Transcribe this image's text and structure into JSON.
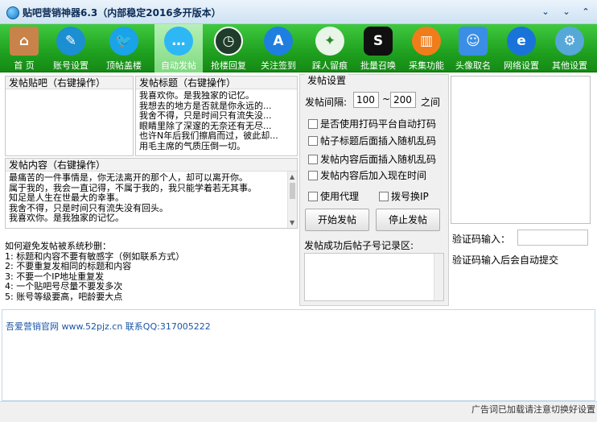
{
  "window": {
    "title": "贴吧营销神器6.3（内部稳定2016多开版本）",
    "controls": [
      "v",
      "v",
      "^",
      "x"
    ]
  },
  "toolbar": {
    "items": [
      {
        "label": "首 页",
        "icon": "house-icon",
        "color": "#c8834a"
      },
      {
        "label": "账号设置",
        "icon": "feather-icon",
        "color": "#1b8fd2"
      },
      {
        "label": "顶帖盖楼",
        "icon": "twitter-bird-icon",
        "color": "#1aa3e8"
      },
      {
        "label": "自动发帖",
        "icon": "chat-bubble-icon",
        "color": "#2db7f5"
      },
      {
        "label": "抢楼回复",
        "icon": "clock-icon",
        "color": "#1f3d2a"
      },
      {
        "label": "关注签到",
        "icon": "appstore-icon",
        "color": "#1e7fe0"
      },
      {
        "label": "踩人留痕",
        "icon": "dragon-icon",
        "color": "#e9f5e9"
      },
      {
        "label": "批量召唤",
        "icon": "skype-icon",
        "color": "#101010"
      },
      {
        "label": "采集功能",
        "icon": "book-icon",
        "color": "#f07d1a"
      },
      {
        "label": "头像取名",
        "icon": "finder-face-icon",
        "color": "#3a8ee6"
      },
      {
        "label": "网络设置",
        "icon": "ie-icon",
        "color": "#1a73d9"
      },
      {
        "label": "其他设置",
        "icon": "gear-icon",
        "color": "#56a8d8"
      }
    ]
  },
  "post_bar": {
    "header": "发帖贴吧（右键操作）"
  },
  "post_title": {
    "header": "发帖标题（右键操作）",
    "lines": [
      "我喜欢你。是我独家的记忆。",
      "我想去的地方是否就是你永远的...",
      "我舍不得，只是时间只有流失没...",
      "眼睛里除了深邃的无奈还有无尽...",
      "也许N年后我们擦肩而过，彼此却...",
      "用毛主席的气质压倒一切。"
    ]
  },
  "post_content": {
    "header": "发帖内容（右键操作）",
    "lines": [
      "最痛苦的一件事情是，你无法离开的那个人，却可以离开你。",
      "属于我的，我会一直记得，不属于我的，我只能学着若无其事。",
      "知足是人生在世最大的幸事。",
      "我舍不得，只是时间只有流失没有回头。",
      "我喜欢你。是我独家的记忆。"
    ]
  },
  "tips": {
    "title": "如何避免发帖被系统秒删：",
    "lines": [
      "1: 标题和内容不要有敏感字（例如联系方式）",
      "2: 不要重复发相同的标题和内容",
      "3: 不要一个IP地址重复发",
      "4: 一个贴吧号尽量不要发多次",
      "5: 账号等级要高，吧龄要大点"
    ]
  },
  "settings": {
    "title": "发帖设置",
    "interval_label": "发帖间隔:",
    "interval_from": "100",
    "interval_sep": "~",
    "interval_to": "200",
    "interval_unit": "之间",
    "checkboxes": [
      "是否使用打码平台自动打码",
      "帖子标题后面插入随机乱码",
      "发帖内容后面插入随机乱码",
      "发帖内容后加入现在时间"
    ],
    "use_proxy": "使用代理",
    "dial_ip": "拨号换IP",
    "start_button": "开始发帖",
    "stop_button": "停止发帖"
  },
  "records": {
    "label": "发帖成功后帖子号记录区:"
  },
  "captcha": {
    "input_label": "验证码输入：",
    "note": "验证码输入后会自动提交"
  },
  "log": {
    "line": "吾爱营销官网 www.52pjz.cn 联系QQ:317005222"
  },
  "status": {
    "text": "广告词已加载请注意切换好设置"
  }
}
